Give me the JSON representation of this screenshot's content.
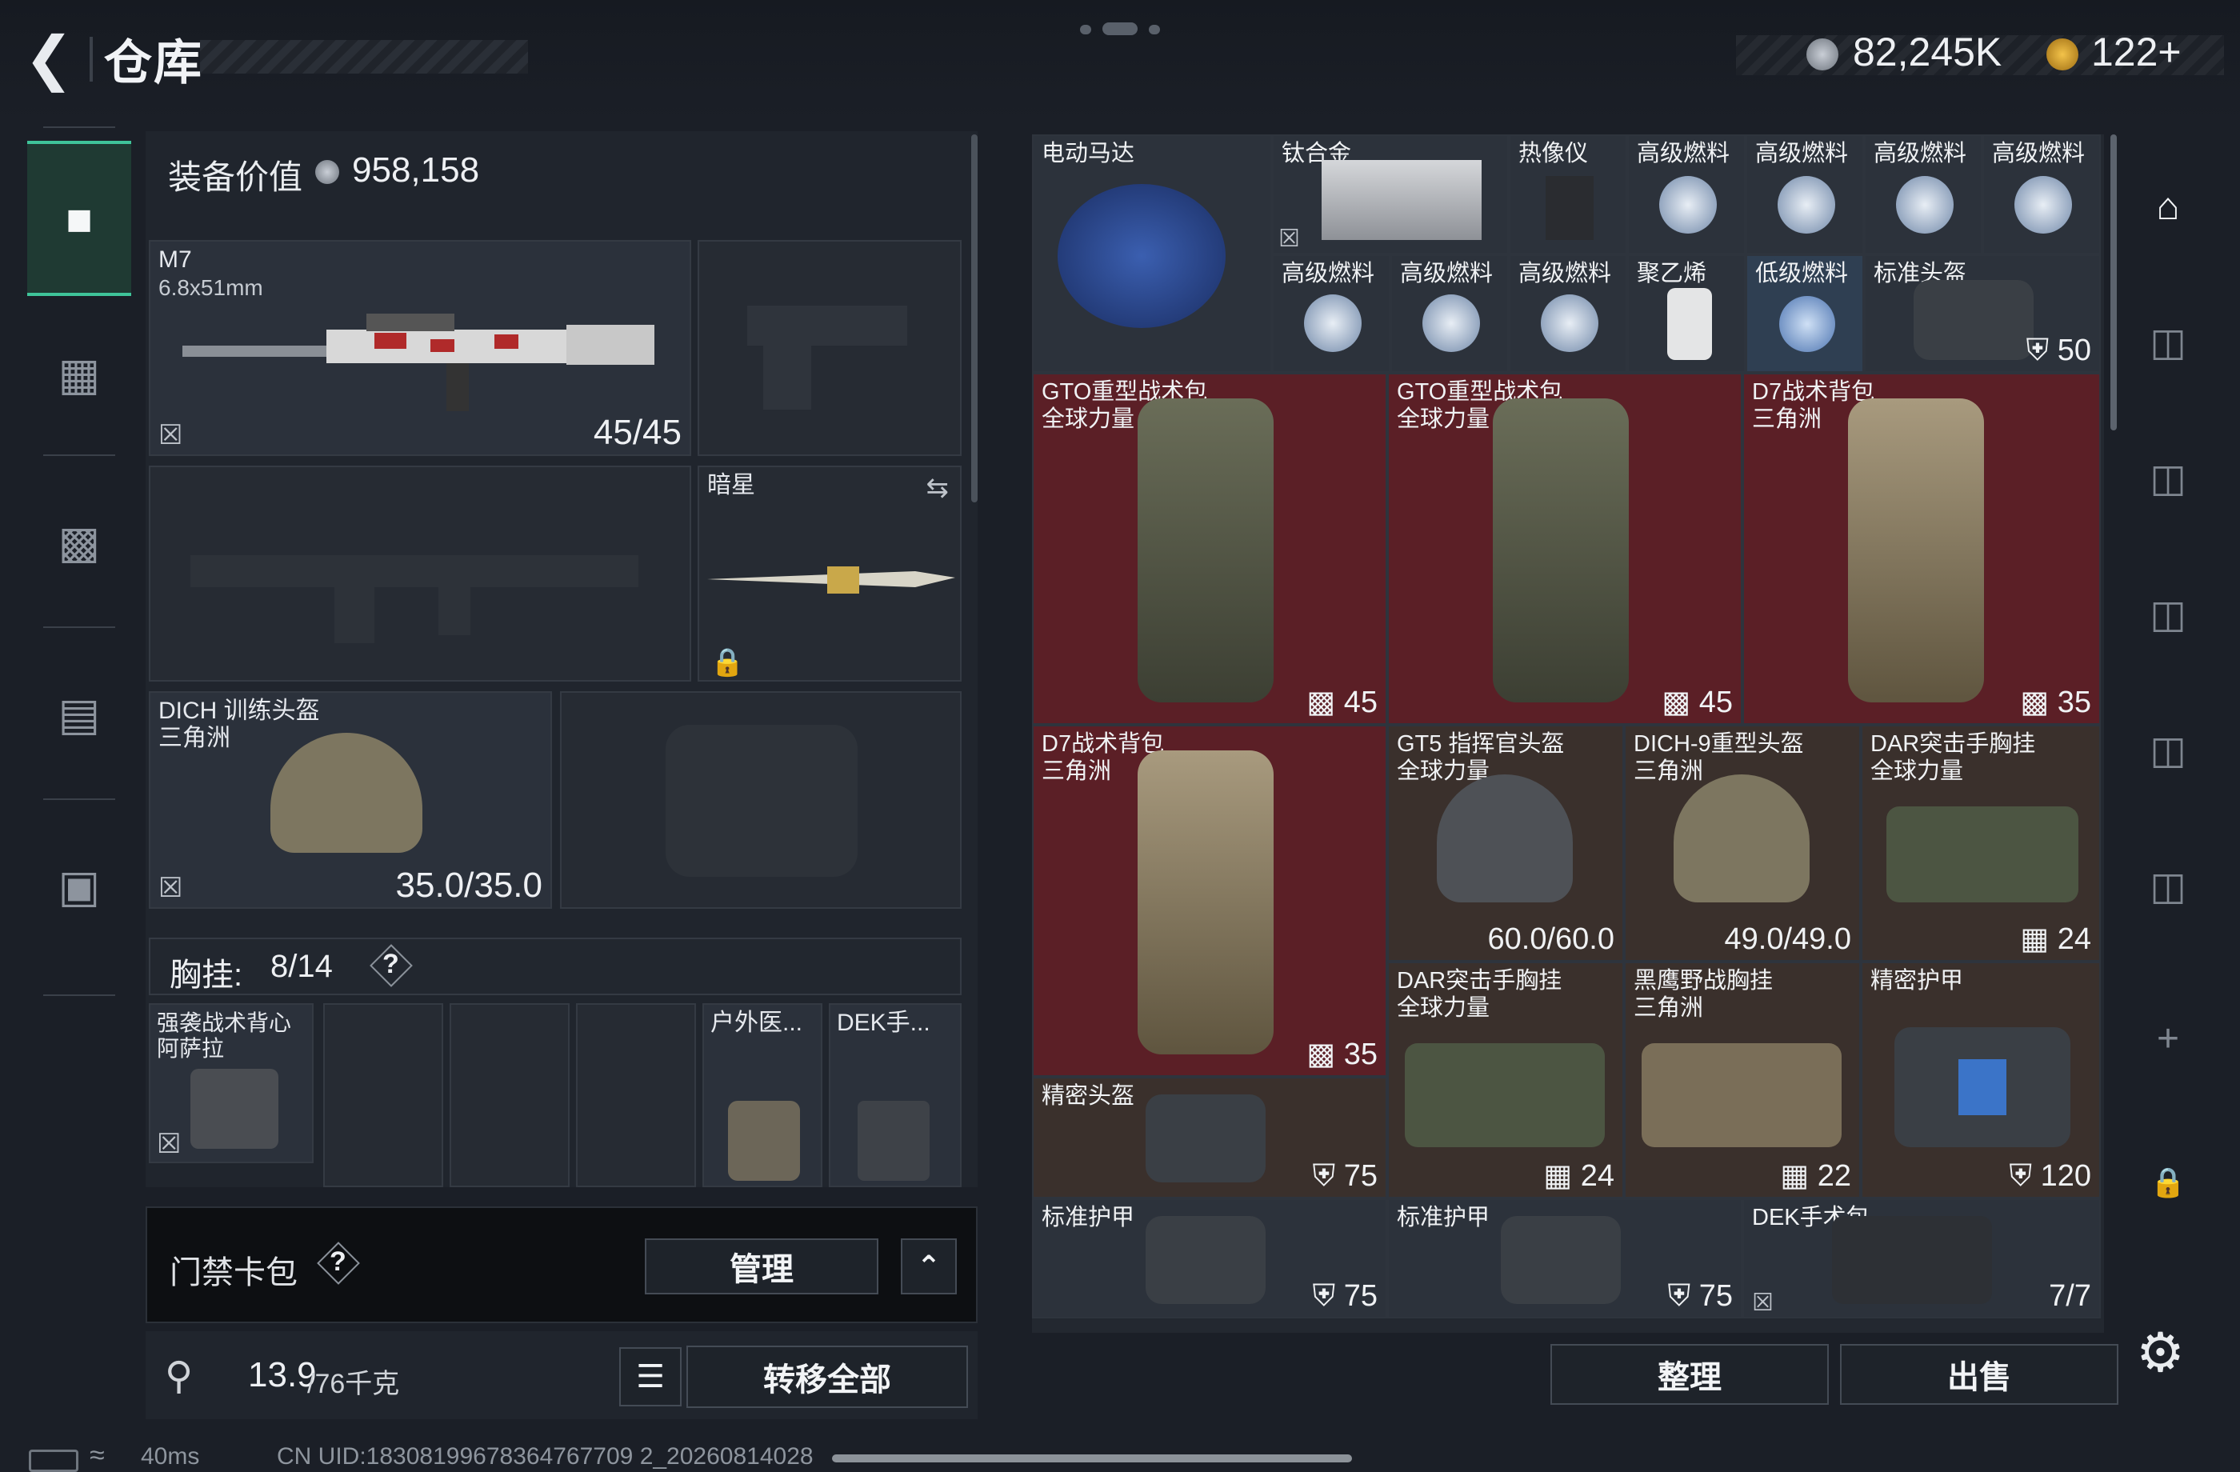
{
  "header": {
    "title": "仓库",
    "currency": "82,245K",
    "coins": "122+"
  },
  "left_panel": {
    "equip_value_label": "装备价值",
    "equip_value": "958,158",
    "weapon_slot": {
      "name": "M7",
      "caliber": "6.8x51mm",
      "ammo": "45/45"
    },
    "melee_slot": {
      "name": "暗星"
    },
    "helmet_slot": {
      "name": "DICH 训练头盔",
      "region": "三角洲",
      "durability": "35.0/35.0"
    },
    "chest_rig": {
      "label": "胸挂:",
      "value": "8/14",
      "help": "?"
    },
    "rig_items": [
      {
        "name": "强袭战术背心",
        "region": "阿萨拉"
      },
      {
        "name": "户外医..."
      },
      {
        "name": "DEK手..."
      }
    ],
    "keycard": {
      "label": "门禁卡包",
      "help": "?",
      "manage": "管理"
    },
    "weight": {
      "current": "13.9",
      "max": "/76千克"
    },
    "transfer_all": "转移全部"
  },
  "grid_items": [
    {
      "name": "电动马达"
    },
    {
      "name": "钛合金"
    },
    {
      "name": "热像仪"
    },
    {
      "name": "高级燃料"
    },
    {
      "name": "高级燃料"
    },
    {
      "name": "高级燃料"
    },
    {
      "name": "高级燃料"
    },
    {
      "name": "高级燃料"
    },
    {
      "name": "高级燃料"
    },
    {
      "name": "高级燃料"
    },
    {
      "name": "聚乙烯"
    },
    {
      "name": "低级燃料"
    },
    {
      "name": "标准头盔",
      "value": "50"
    },
    {
      "name": "GTO重型战术包",
      "region": "全球力量",
      "value": "45"
    },
    {
      "name": "GTO重型战术包",
      "region": "全球力量",
      "value": "45"
    },
    {
      "name": "D7战术背包",
      "region": "三角洲",
      "value": "35"
    },
    {
      "name": "D7战术背包",
      "region": "三角洲",
      "value": "35"
    },
    {
      "name": "GT5 指挥官头盔",
      "region": "全球力量",
      "value": "60.0/60.0"
    },
    {
      "name": "DICH-9重型头盔",
      "region": "三角洲",
      "value": "49.0/49.0"
    },
    {
      "name": "DAR突击手胸挂",
      "region": "全球力量",
      "value": "24"
    },
    {
      "name": "DAR突击手胸挂",
      "region": "全球力量",
      "value": "24"
    },
    {
      "name": "黑鹰野战胸挂",
      "region": "三角洲",
      "value": "22"
    },
    {
      "name": "精密护甲",
      "value": "120"
    },
    {
      "name": "精密头盔",
      "value": "75"
    },
    {
      "name": "标准护甲",
      "value": "75"
    },
    {
      "name": "标准护甲",
      "value": "75"
    },
    {
      "name": "DEK手术包",
      "value": "7/7"
    }
  ],
  "actions": {
    "sort": "整理",
    "sell": "出售"
  },
  "status": {
    "ping": "40ms",
    "uid": "CN UID:18308199678364767709 2_20260814028"
  },
  "icons": [
    "back-arrow-icon",
    "coin-icon",
    "gold-coin-icon",
    "gun-icon",
    "vest-icon",
    "backpack-icon",
    "case-icon",
    "briefcase-icon",
    "lock-icon",
    "list-icon",
    "gear-icon",
    "plus-icon",
    "swap-icon",
    "help-icon"
  ]
}
